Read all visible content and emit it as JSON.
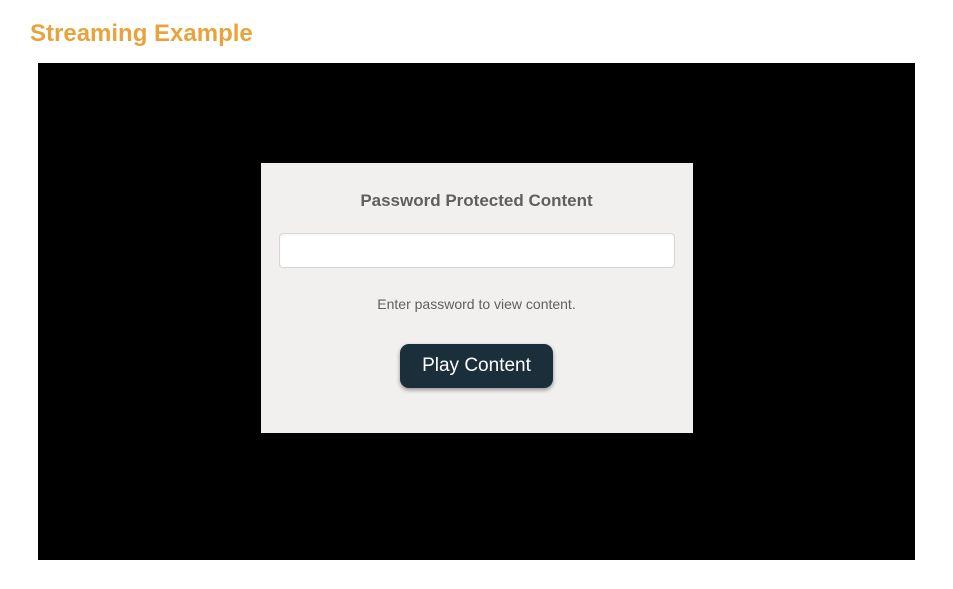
{
  "page": {
    "title": "Streaming Example"
  },
  "panel": {
    "heading": "Password Protected Content",
    "hint": "Enter password to view content.",
    "input_value": "",
    "button_label": "Play Content"
  }
}
